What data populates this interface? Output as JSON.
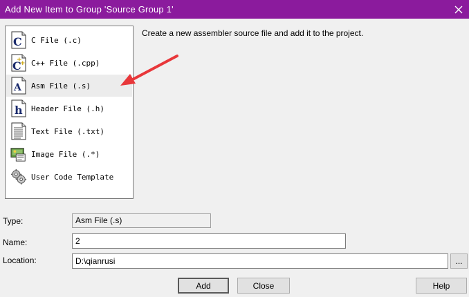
{
  "window": {
    "title": "Add New Item to Group 'Source Group 1'",
    "titlebar_color": "#8b1b9d"
  },
  "file_types": [
    {
      "label": "C File (.c)",
      "icon": "c-file-icon"
    },
    {
      "label": "C++ File (.cpp)",
      "icon": "cpp-file-icon"
    },
    {
      "label": "Asm File (.s)",
      "icon": "asm-file-icon",
      "selected": true
    },
    {
      "label": "Header File (.h)",
      "icon": "header-file-icon"
    },
    {
      "label": "Text File (.txt)",
      "icon": "text-file-icon"
    },
    {
      "label": "Image File (.*)",
      "icon": "image-file-icon"
    },
    {
      "label": "User Code Template",
      "icon": "user-code-template-icon"
    }
  ],
  "description": "Create a new assembler source file and add it to the project.",
  "form": {
    "type_label": "Type:",
    "type_value": "Asm File (.s)",
    "name_label": "Name:",
    "name_value": "2",
    "location_label": "Location:",
    "location_value": "D:\\qianrusi",
    "browse_label": "..."
  },
  "buttons": {
    "add": "Add",
    "close": "Close",
    "help": "Help"
  },
  "annotation_arrow_color": "#e8373a"
}
